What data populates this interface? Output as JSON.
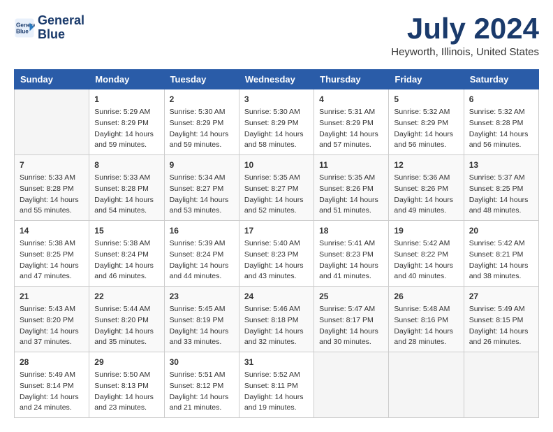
{
  "header": {
    "logo_line1": "General",
    "logo_line2": "Blue",
    "month": "July 2024",
    "location": "Heyworth, Illinois, United States"
  },
  "weekdays": [
    "Sunday",
    "Monday",
    "Tuesday",
    "Wednesday",
    "Thursday",
    "Friday",
    "Saturday"
  ],
  "weeks": [
    [
      {
        "day": "",
        "empty": true
      },
      {
        "day": "1",
        "sunrise": "Sunrise: 5:29 AM",
        "sunset": "Sunset: 8:29 PM",
        "daylight": "Daylight: 14 hours and 59 minutes."
      },
      {
        "day": "2",
        "sunrise": "Sunrise: 5:30 AM",
        "sunset": "Sunset: 8:29 PM",
        "daylight": "Daylight: 14 hours and 59 minutes."
      },
      {
        "day": "3",
        "sunrise": "Sunrise: 5:30 AM",
        "sunset": "Sunset: 8:29 PM",
        "daylight": "Daylight: 14 hours and 58 minutes."
      },
      {
        "day": "4",
        "sunrise": "Sunrise: 5:31 AM",
        "sunset": "Sunset: 8:29 PM",
        "daylight": "Daylight: 14 hours and 57 minutes."
      },
      {
        "day": "5",
        "sunrise": "Sunrise: 5:32 AM",
        "sunset": "Sunset: 8:29 PM",
        "daylight": "Daylight: 14 hours and 56 minutes."
      },
      {
        "day": "6",
        "sunrise": "Sunrise: 5:32 AM",
        "sunset": "Sunset: 8:28 PM",
        "daylight": "Daylight: 14 hours and 56 minutes."
      }
    ],
    [
      {
        "day": "7",
        "sunrise": "Sunrise: 5:33 AM",
        "sunset": "Sunset: 8:28 PM",
        "daylight": "Daylight: 14 hours and 55 minutes."
      },
      {
        "day": "8",
        "sunrise": "Sunrise: 5:33 AM",
        "sunset": "Sunset: 8:28 PM",
        "daylight": "Daylight: 14 hours and 54 minutes."
      },
      {
        "day": "9",
        "sunrise": "Sunrise: 5:34 AM",
        "sunset": "Sunset: 8:27 PM",
        "daylight": "Daylight: 14 hours and 53 minutes."
      },
      {
        "day": "10",
        "sunrise": "Sunrise: 5:35 AM",
        "sunset": "Sunset: 8:27 PM",
        "daylight": "Daylight: 14 hours and 52 minutes."
      },
      {
        "day": "11",
        "sunrise": "Sunrise: 5:35 AM",
        "sunset": "Sunset: 8:26 PM",
        "daylight": "Daylight: 14 hours and 51 minutes."
      },
      {
        "day": "12",
        "sunrise": "Sunrise: 5:36 AM",
        "sunset": "Sunset: 8:26 PM",
        "daylight": "Daylight: 14 hours and 49 minutes."
      },
      {
        "day": "13",
        "sunrise": "Sunrise: 5:37 AM",
        "sunset": "Sunset: 8:25 PM",
        "daylight": "Daylight: 14 hours and 48 minutes."
      }
    ],
    [
      {
        "day": "14",
        "sunrise": "Sunrise: 5:38 AM",
        "sunset": "Sunset: 8:25 PM",
        "daylight": "Daylight: 14 hours and 47 minutes."
      },
      {
        "day": "15",
        "sunrise": "Sunrise: 5:38 AM",
        "sunset": "Sunset: 8:24 PM",
        "daylight": "Daylight: 14 hours and 46 minutes."
      },
      {
        "day": "16",
        "sunrise": "Sunrise: 5:39 AM",
        "sunset": "Sunset: 8:24 PM",
        "daylight": "Daylight: 14 hours and 44 minutes."
      },
      {
        "day": "17",
        "sunrise": "Sunrise: 5:40 AM",
        "sunset": "Sunset: 8:23 PM",
        "daylight": "Daylight: 14 hours and 43 minutes."
      },
      {
        "day": "18",
        "sunrise": "Sunrise: 5:41 AM",
        "sunset": "Sunset: 8:23 PM",
        "daylight": "Daylight: 14 hours and 41 minutes."
      },
      {
        "day": "19",
        "sunrise": "Sunrise: 5:42 AM",
        "sunset": "Sunset: 8:22 PM",
        "daylight": "Daylight: 14 hours and 40 minutes."
      },
      {
        "day": "20",
        "sunrise": "Sunrise: 5:42 AM",
        "sunset": "Sunset: 8:21 PM",
        "daylight": "Daylight: 14 hours and 38 minutes."
      }
    ],
    [
      {
        "day": "21",
        "sunrise": "Sunrise: 5:43 AM",
        "sunset": "Sunset: 8:20 PM",
        "daylight": "Daylight: 14 hours and 37 minutes."
      },
      {
        "day": "22",
        "sunrise": "Sunrise: 5:44 AM",
        "sunset": "Sunset: 8:20 PM",
        "daylight": "Daylight: 14 hours and 35 minutes."
      },
      {
        "day": "23",
        "sunrise": "Sunrise: 5:45 AM",
        "sunset": "Sunset: 8:19 PM",
        "daylight": "Daylight: 14 hours and 33 minutes."
      },
      {
        "day": "24",
        "sunrise": "Sunrise: 5:46 AM",
        "sunset": "Sunset: 8:18 PM",
        "daylight": "Daylight: 14 hours and 32 minutes."
      },
      {
        "day": "25",
        "sunrise": "Sunrise: 5:47 AM",
        "sunset": "Sunset: 8:17 PM",
        "daylight": "Daylight: 14 hours and 30 minutes."
      },
      {
        "day": "26",
        "sunrise": "Sunrise: 5:48 AM",
        "sunset": "Sunset: 8:16 PM",
        "daylight": "Daylight: 14 hours and 28 minutes."
      },
      {
        "day": "27",
        "sunrise": "Sunrise: 5:49 AM",
        "sunset": "Sunset: 8:15 PM",
        "daylight": "Daylight: 14 hours and 26 minutes."
      }
    ],
    [
      {
        "day": "28",
        "sunrise": "Sunrise: 5:49 AM",
        "sunset": "Sunset: 8:14 PM",
        "daylight": "Daylight: 14 hours and 24 minutes."
      },
      {
        "day": "29",
        "sunrise": "Sunrise: 5:50 AM",
        "sunset": "Sunset: 8:13 PM",
        "daylight": "Daylight: 14 hours and 23 minutes."
      },
      {
        "day": "30",
        "sunrise": "Sunrise: 5:51 AM",
        "sunset": "Sunset: 8:12 PM",
        "daylight": "Daylight: 14 hours and 21 minutes."
      },
      {
        "day": "31",
        "sunrise": "Sunrise: 5:52 AM",
        "sunset": "Sunset: 8:11 PM",
        "daylight": "Daylight: 14 hours and 19 minutes."
      },
      {
        "day": "",
        "empty": true
      },
      {
        "day": "",
        "empty": true
      },
      {
        "day": "",
        "empty": true
      }
    ]
  ]
}
